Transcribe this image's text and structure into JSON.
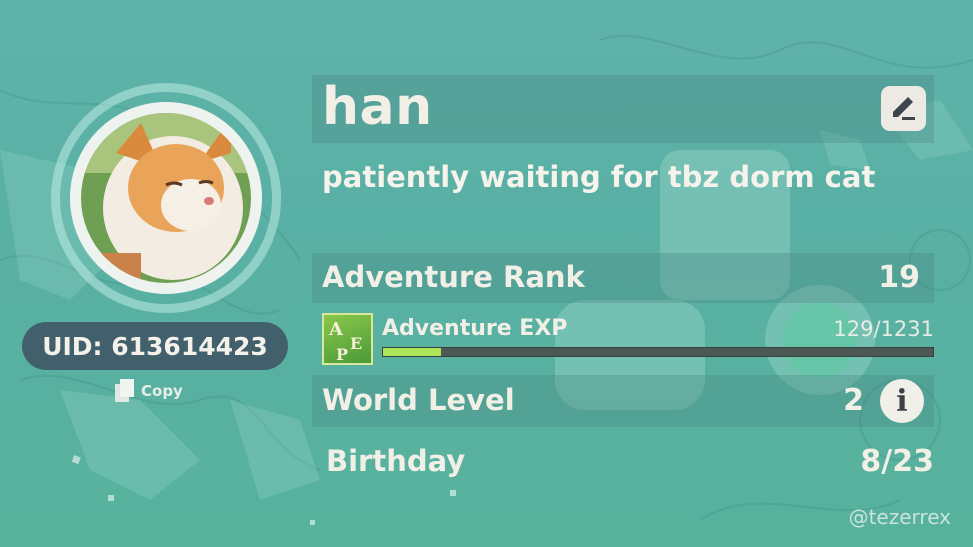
{
  "profile": {
    "name": "han",
    "signature": "patiently waiting for tbz dorm cat",
    "uid_text": "UID: 613614423",
    "copy_label": "Copy"
  },
  "stats": {
    "adventure_rank_label": "Adventure Rank",
    "adventure_rank_value": "19",
    "adventure_exp_label": "Adventure EXP",
    "adventure_exp_value": "129/1231",
    "adventure_exp_progress": 0.105,
    "world_level_label": "World Level",
    "world_level_value": "2",
    "birthday_label": "Birthday",
    "birthday_value": "8/23"
  },
  "watermark": "@tezerrex",
  "exp_icon_letters": "AEP",
  "icons": {
    "edit": "pencil-icon",
    "info": "info-icon",
    "copy": "copy-icon"
  },
  "colors": {
    "background": "#5fb3a9",
    "exp_fill": "#aee65a",
    "uid_pill": "#3c4e60"
  }
}
